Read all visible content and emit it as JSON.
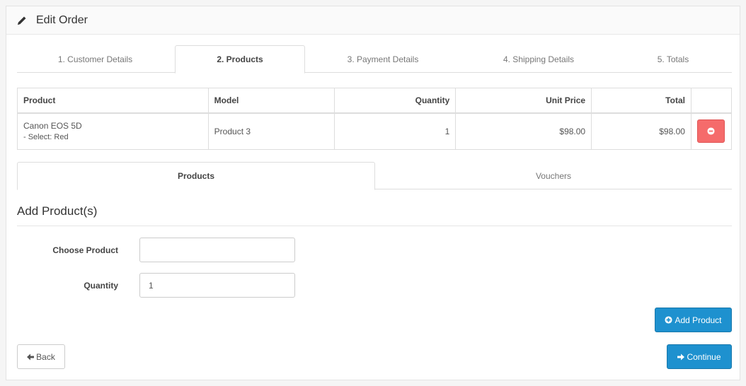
{
  "header": {
    "title": "Edit Order",
    "icon": "pencil-icon"
  },
  "steps": [
    {
      "label": "1. Customer Details",
      "active": false
    },
    {
      "label": "2. Products",
      "active": true
    },
    {
      "label": "3. Payment Details",
      "active": false
    },
    {
      "label": "4. Shipping Details",
      "active": false
    },
    {
      "label": "5. Totals",
      "active": false
    }
  ],
  "cart": {
    "columns": [
      "Product",
      "Model",
      "Quantity",
      "Unit Price",
      "Total"
    ],
    "rows": [
      {
        "product": "Canon EOS 5D",
        "option": "- Select: Red",
        "model": "Product 3",
        "quantity": "1",
        "unit_price": "$98.00",
        "total": "$98.00",
        "remove_icon": "minus-circle-icon"
      }
    ]
  },
  "sub_tabs": [
    {
      "label": "Products",
      "active": true
    },
    {
      "label": "Vouchers",
      "active": false
    }
  ],
  "add_section": {
    "title": "Add Product(s)",
    "choose_product_label": "Choose Product",
    "choose_product_value": "",
    "quantity_label": "Quantity",
    "quantity_value": "1",
    "add_button": "Add Product",
    "add_icon": "plus-circle-icon"
  },
  "footer": {
    "back_label": "Back",
    "back_icon": "arrow-left-icon",
    "continue_label": "Continue",
    "continue_icon": "arrow-right-icon"
  },
  "colors": {
    "primary": "#1e91cf",
    "danger": "#f56b6b"
  }
}
